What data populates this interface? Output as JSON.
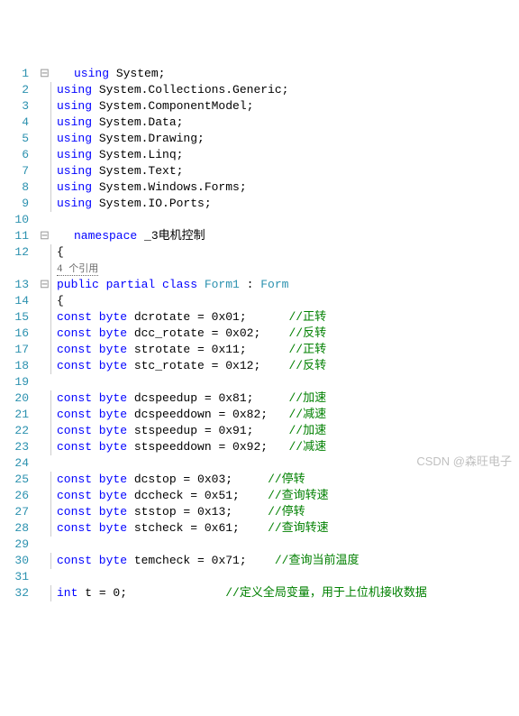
{
  "lineCount": 32,
  "extraRefLine": 12,
  "refLabel": "4 个引用",
  "lines": {
    "1": {
      "outline": "⊟",
      "indent": 1,
      "tokens": [
        {
          "t": "using ",
          "c": "kw"
        },
        {
          "t": "System;",
          "c": "ns"
        }
      ]
    },
    "2": {
      "outline": " ",
      "indent": 1,
      "bar": true,
      "tokens": [
        {
          "t": "using ",
          "c": "kw"
        },
        {
          "t": "System.Collections.Generic;",
          "c": "ns"
        }
      ]
    },
    "3": {
      "outline": " ",
      "indent": 1,
      "bar": true,
      "tokens": [
        {
          "t": "using ",
          "c": "kw"
        },
        {
          "t": "System.ComponentModel;",
          "c": "ns"
        }
      ]
    },
    "4": {
      "outline": " ",
      "indent": 1,
      "bar": true,
      "tokens": [
        {
          "t": "using ",
          "c": "kw"
        },
        {
          "t": "System.Data;",
          "c": "ns"
        }
      ]
    },
    "5": {
      "outline": " ",
      "indent": 1,
      "bar": true,
      "tokens": [
        {
          "t": "using ",
          "c": "kw"
        },
        {
          "t": "System.Drawing;",
          "c": "ns"
        }
      ]
    },
    "6": {
      "outline": " ",
      "indent": 1,
      "bar": true,
      "tokens": [
        {
          "t": "using ",
          "c": "kw"
        },
        {
          "t": "System.Linq;",
          "c": "ns"
        }
      ]
    },
    "7": {
      "outline": " ",
      "indent": 1,
      "bar": true,
      "tokens": [
        {
          "t": "using ",
          "c": "kw"
        },
        {
          "t": "System.Text;",
          "c": "ns"
        }
      ]
    },
    "8": {
      "outline": " ",
      "indent": 1,
      "bar": true,
      "tokens": [
        {
          "t": "using ",
          "c": "kw"
        },
        {
          "t": "System.Windows.Forms;",
          "c": "ns"
        }
      ]
    },
    "9": {
      "outline": " ",
      "indent": 1,
      "bar": true,
      "tokens": [
        {
          "t": "using ",
          "c": "kw"
        },
        {
          "t": "System.IO.Ports;",
          "c": "ns"
        }
      ]
    },
    "10": {
      "outline": " ",
      "indent": 1,
      "tokens": []
    },
    "11": {
      "outline": "⊟",
      "indent": 1,
      "tokens": [
        {
          "t": "namespace ",
          "c": "kw"
        },
        {
          "t": "_3电机控制",
          "c": "ns"
        }
      ]
    },
    "12": {
      "outline": " ",
      "indent": 1,
      "bar": true,
      "tokens": [
        {
          "t": "{",
          "c": "ns"
        }
      ]
    },
    "12b": {
      "outline": " ",
      "indent": 2,
      "bar": true,
      "reflink": true
    },
    "13": {
      "outline": "⊟",
      "indent": 2,
      "bar": true,
      "tokens": [
        {
          "t": "public partial class ",
          "c": "kw"
        },
        {
          "t": "Form1",
          "c": "type"
        },
        {
          "t": " : ",
          "c": "ns"
        },
        {
          "t": "Form",
          "c": "type"
        }
      ]
    },
    "14": {
      "outline": " ",
      "indent": 2,
      "bar": true,
      "tokens": [
        {
          "t": "{",
          "c": "ns"
        }
      ]
    },
    "15": {
      "outline": " ",
      "indent": 3,
      "bar": true,
      "tokens": [
        {
          "t": "const byte ",
          "c": "kw"
        },
        {
          "t": "dcrotate = 0x01;      ",
          "c": "ns"
        },
        {
          "t": "//正转",
          "c": "comment"
        }
      ]
    },
    "16": {
      "outline": " ",
      "indent": 3,
      "bar": true,
      "tokens": [
        {
          "t": "const byte ",
          "c": "kw"
        },
        {
          "t": "dcc_rotate = 0x02;    ",
          "c": "ns"
        },
        {
          "t": "//反转",
          "c": "comment"
        }
      ]
    },
    "17": {
      "outline": " ",
      "indent": 3,
      "bar": true,
      "tokens": [
        {
          "t": "const byte ",
          "c": "kw"
        },
        {
          "t": "strotate = 0x11;      ",
          "c": "ns"
        },
        {
          "t": "//正转",
          "c": "comment"
        }
      ]
    },
    "18": {
      "outline": " ",
      "indent": 3,
      "bar": true,
      "tokens": [
        {
          "t": "const byte ",
          "c": "kw"
        },
        {
          "t": "stc_rotate = 0x12;    ",
          "c": "ns"
        },
        {
          "t": "//反转",
          "c": "comment"
        }
      ]
    },
    "19": {
      "outline": " ",
      "indent": 3,
      "bar": true,
      "tokens": []
    },
    "20": {
      "outline": " ",
      "indent": 3,
      "bar": true,
      "tokens": [
        {
          "t": "const byte ",
          "c": "kw"
        },
        {
          "t": "dcspeedup = 0x81;     ",
          "c": "ns"
        },
        {
          "t": "//加速",
          "c": "comment"
        }
      ]
    },
    "21": {
      "outline": " ",
      "indent": 3,
      "bar": true,
      "tokens": [
        {
          "t": "const byte ",
          "c": "kw"
        },
        {
          "t": "dcspeeddown = 0x82;   ",
          "c": "ns"
        },
        {
          "t": "//减速",
          "c": "comment"
        }
      ]
    },
    "22": {
      "outline": " ",
      "indent": 3,
      "bar": true,
      "tokens": [
        {
          "t": "const byte ",
          "c": "kw"
        },
        {
          "t": "stspeedup = 0x91;     ",
          "c": "ns"
        },
        {
          "t": "//加速",
          "c": "comment"
        }
      ]
    },
    "23": {
      "outline": " ",
      "indent": 3,
      "bar": true,
      "tokens": [
        {
          "t": "const byte ",
          "c": "kw"
        },
        {
          "t": "stspeeddown = 0x92;   ",
          "c": "ns"
        },
        {
          "t": "//减速",
          "c": "comment"
        }
      ]
    },
    "24": {
      "outline": " ",
      "indent": 3,
      "bar": true,
      "tokens": []
    },
    "25": {
      "outline": " ",
      "indent": 3,
      "bar": true,
      "tokens": [
        {
          "t": "const byte ",
          "c": "kw"
        },
        {
          "t": "dcstop = 0x03;     ",
          "c": "ns"
        },
        {
          "t": "//停转",
          "c": "comment"
        }
      ]
    },
    "26": {
      "outline": " ",
      "indent": 3,
      "bar": true,
      "tokens": [
        {
          "t": "const byte ",
          "c": "kw"
        },
        {
          "t": "dccheck = 0x51;    ",
          "c": "ns"
        },
        {
          "t": "//查询转速",
          "c": "comment"
        }
      ]
    },
    "27": {
      "outline": " ",
      "indent": 3,
      "bar": true,
      "tokens": [
        {
          "t": "const byte ",
          "c": "kw"
        },
        {
          "t": "ststop = 0x13;     ",
          "c": "ns"
        },
        {
          "t": "//停转",
          "c": "comment"
        }
      ]
    },
    "28": {
      "outline": " ",
      "indent": 3,
      "bar": true,
      "tokens": [
        {
          "t": "const byte ",
          "c": "kw"
        },
        {
          "t": "stcheck = 0x61;    ",
          "c": "ns"
        },
        {
          "t": "//查询转速",
          "c": "comment"
        }
      ]
    },
    "29": {
      "outline": " ",
      "indent": 3,
      "bar": true,
      "tokens": []
    },
    "30": {
      "outline": " ",
      "indent": 3,
      "bar": true,
      "tokens": [
        {
          "t": "const byte ",
          "c": "kw"
        },
        {
          "t": "temcheck = 0x71;    ",
          "c": "ns"
        },
        {
          "t": "//查询当前温度",
          "c": "comment"
        }
      ]
    },
    "31": {
      "outline": " ",
      "indent": 3,
      "bar": true,
      "tokens": []
    },
    "32": {
      "outline": " ",
      "indent": 3,
      "bar": true,
      "tokens": [
        {
          "t": "int ",
          "c": "kw"
        },
        {
          "t": "t = 0;              ",
          "c": "ns"
        },
        {
          "t": "//定义全局变量，用于上位机接收数据",
          "c": "comment"
        }
      ]
    }
  },
  "watermark": "CSDN @森旺电子"
}
